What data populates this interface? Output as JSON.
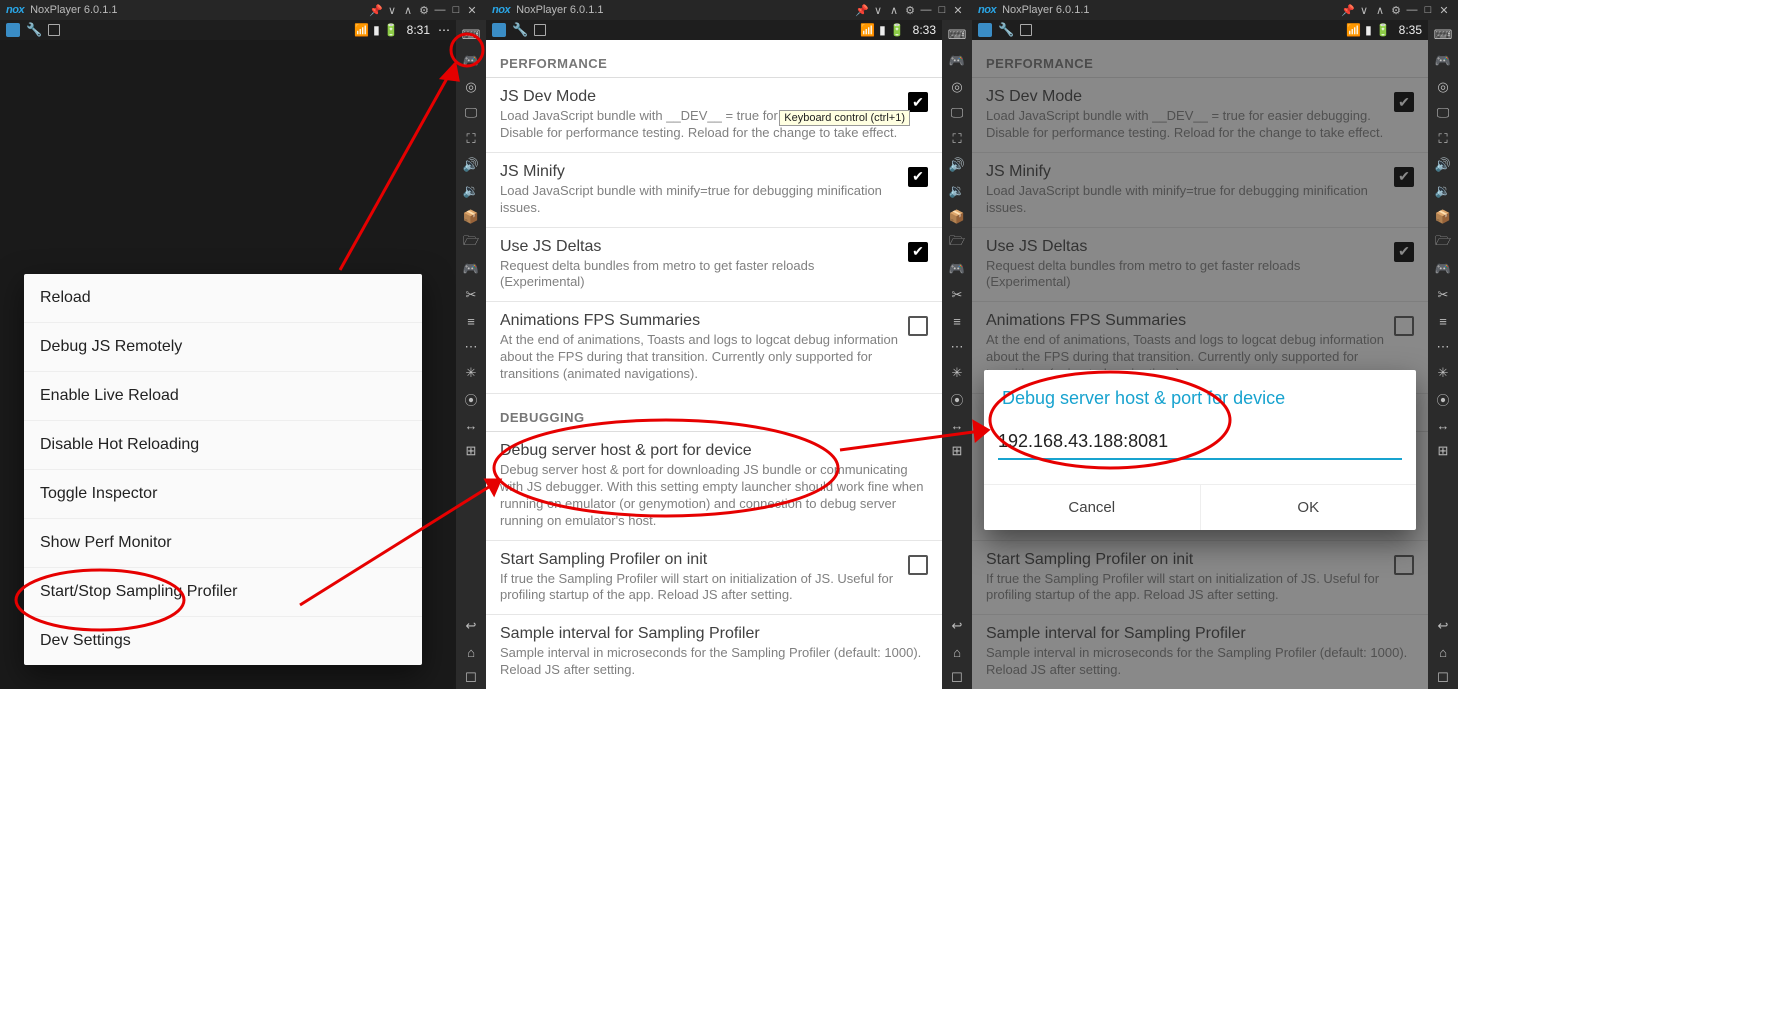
{
  "app": {
    "name": "NoxPlayer 6.0.1.1"
  },
  "clocks": [
    "8:31",
    "8:33",
    "8:35"
  ],
  "tooltip": "Keyboard control (ctrl+1)",
  "dev_menu": {
    "items": [
      "Reload",
      "Debug JS Remotely",
      "Enable Live Reload",
      "Disable Hot Reloading",
      "Toggle Inspector",
      "Show Perf Monitor",
      "Start/Stop Sampling Profiler",
      "Dev Settings"
    ]
  },
  "settings": {
    "section_perf": "PERFORMANCE",
    "section_debug": "DEBUGGING",
    "js_dev_mode": {
      "title": "JS Dev Mode",
      "desc": "Load JavaScript bundle with __DEV__ = true for easier debugging.  Disable for performance testing. Reload for the change to take effect.",
      "checked": true
    },
    "js_minify": {
      "title": "JS Minify",
      "desc": "Load JavaScript bundle with minify=true for debugging minification issues.",
      "checked": true
    },
    "js_deltas": {
      "title": "Use JS Deltas",
      "desc": "Request delta bundles from metro to get faster reloads (Experimental)",
      "checked": true
    },
    "anim_fps": {
      "title": "Animations FPS Summaries",
      "desc": "At the end of animations, Toasts and logs to logcat debug information about the FPS during that transition. Currently only supported for transitions (animated navigations).",
      "checked": false
    },
    "debug_host": {
      "title": "Debug server host & port for device",
      "desc": "Debug server host & port for downloading JS bundle or communicating with JS debugger. With this setting empty launcher should work fine when running on emulator (or genymotion) and connection to debug server running on emulator's host."
    },
    "sampling_init": {
      "title": "Start Sampling Profiler on init",
      "desc": "If true the Sampling Profiler will start on initialization of JS. Useful for profiling startup of the app. Reload JS after setting.",
      "checked": false
    },
    "sample_interval": {
      "title": "Sample interval for Sampling Profiler",
      "desc": "Sample interval in microseconds for the Sampling Profiler (default: 1000). Reload JS after setting."
    }
  },
  "dialog": {
    "title": "Debug server host & port for device",
    "value": "192.168.43.188:8081",
    "cancel": "Cancel",
    "ok": "OK"
  },
  "win_icons": {
    "pin": "📌",
    "down": "∨",
    "up": "∧",
    "gear": "⚙",
    "min": "—",
    "max": "□",
    "close": "✕"
  },
  "rail": {
    "keyboard": "⌨",
    "gamepad": "🎮",
    "location": "◎",
    "monitor": "🖵",
    "fullscreen": "⛶",
    "vol_up": "🔊",
    "vol_down": "🔉",
    "apk": "📦",
    "folder": "🗁",
    "controller": "🎮",
    "cut": "✂",
    "menu": "≡",
    "more": "⋯",
    "bright": "✳",
    "rec": "⦿",
    "side": "↔",
    "grid": "⊞",
    "back": "↩",
    "home": "⌂",
    "recent": "☐"
  }
}
